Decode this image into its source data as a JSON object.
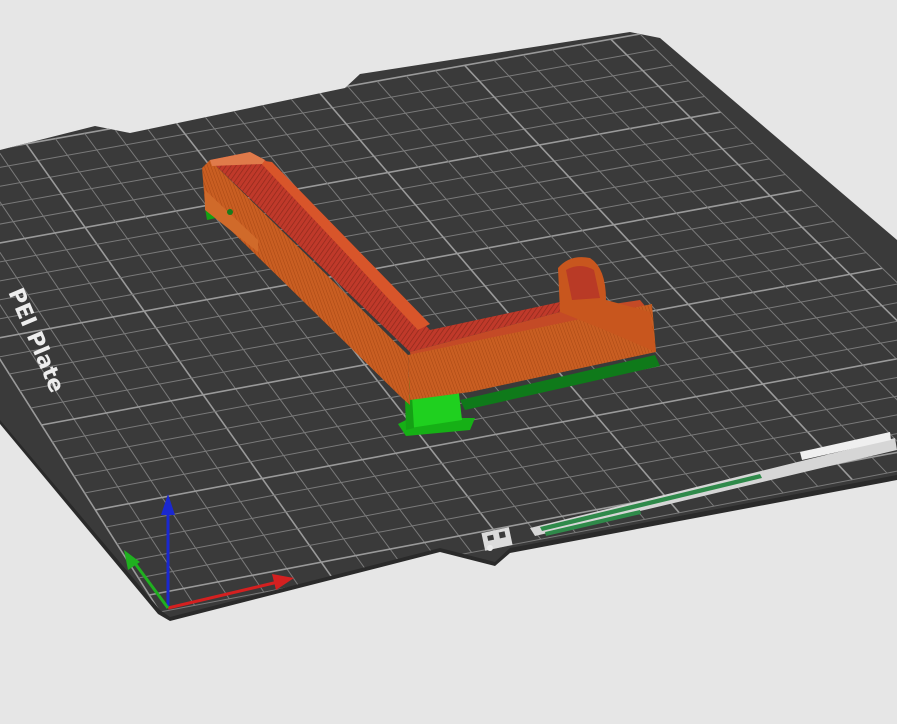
{
  "viewport": {
    "plate_label": "PEI Plate",
    "colors": {
      "background": "#e6e6e6",
      "plate": "#3a3a3a",
      "plate_edge": "#2a2a2a",
      "grid": "#8c8c8c",
      "model_main": "#c85a1e",
      "model_top": "#c03a28",
      "model_infill": "#b84a32",
      "support": "#1fcf1f",
      "axis_x": "#d42020",
      "axis_y": "#20b020",
      "axis_z": "#1a28d0"
    },
    "icons": [
      "axis-gizmo",
      "plate-logo-icon"
    ]
  }
}
